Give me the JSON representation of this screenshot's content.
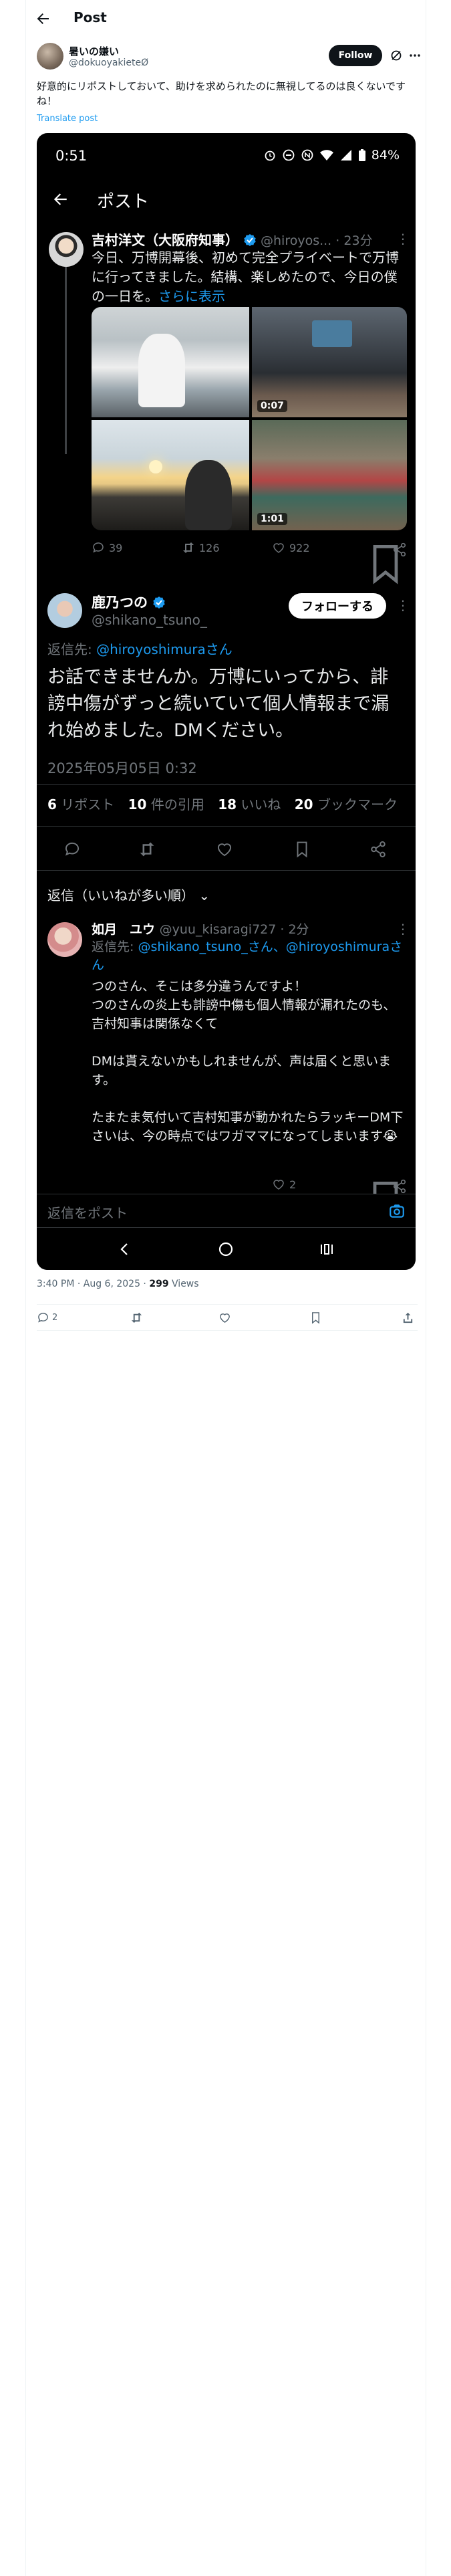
{
  "header": {
    "title": "Post"
  },
  "author": {
    "name": "暑いの嫌い",
    "handle": "@dokuoyakieteØ",
    "follow_label": "Follow"
  },
  "post": {
    "text": "好意的にリポストしておいて、助けを求められたのに無視してるのは良くないですね！",
    "translate_label": "Translate post"
  },
  "screenshot": {
    "status_time": "0:51",
    "battery": "84%",
    "nav_title": "ポスト",
    "quoted": {
      "name": "吉村洋文（大阪府知事）",
      "handle": "@hiroyos...",
      "time": "· 23分",
      "text": "今日、万博開幕後、初めて完全プライベートで万博に行ってきました。結構、楽しめたので、今日の僕の一日を。",
      "more_label": "さらに表示",
      "video_badges": [
        "0:07",
        "1:01"
      ],
      "replies": "39",
      "reposts": "126",
      "likes": "922"
    },
    "main": {
      "name": "鹿乃つの",
      "handle": "@shikano_tsuno_",
      "follow_label": "フォローする",
      "reply_to_label": "返信先:",
      "reply_to_link": "@hiroyoshimuraさん",
      "text": "お話できませんか。万博にいってから、誹謗中傷がずっと続いていて個人情報まで漏れ始めました。DMください。",
      "date": "2025年05月05日 0:32",
      "stats": [
        {
          "value": "6",
          "label": "リポスト"
        },
        {
          "value": "10",
          "label": "件の引用"
        },
        {
          "value": "18",
          "label": "いいね"
        },
        {
          "value": "20",
          "label": "ブックマーク"
        }
      ],
      "sort_label": "返信（いいねが多い順）"
    },
    "reply": {
      "name": "如月　ユウ",
      "handle": "@yuu_kisaragi727 · 2分",
      "reply_to_label": "返信先:",
      "reply_to_links": "@shikano_tsuno_さん、@hiroyoshimuraさん",
      "text": "つのさん、そこは多分違うんですよ！\nつのさんの炎上も誹謗中傷も個人情報が漏れたのも、吉村知事は関係なくて\n\nDMは貰えないかもしれませんが、声は届くと思います。\n\nたまたま気付いて吉村知事が動かれたらラッキーDM下さいは、今の時点ではワガママになってしまいます😭",
      "likes": "2"
    },
    "input_placeholder": "返信をポスト"
  },
  "meta": {
    "time": "3:40 PM · Aug 6, 2025 · ",
    "views": "299",
    "views_label": " Views"
  },
  "actions": {
    "replies": "2"
  },
  "colors": {
    "accent": "#1d9bf0",
    "phone_bg": "#000000",
    "text_primary": "#0f1419",
    "text_secondary": "#536471"
  }
}
